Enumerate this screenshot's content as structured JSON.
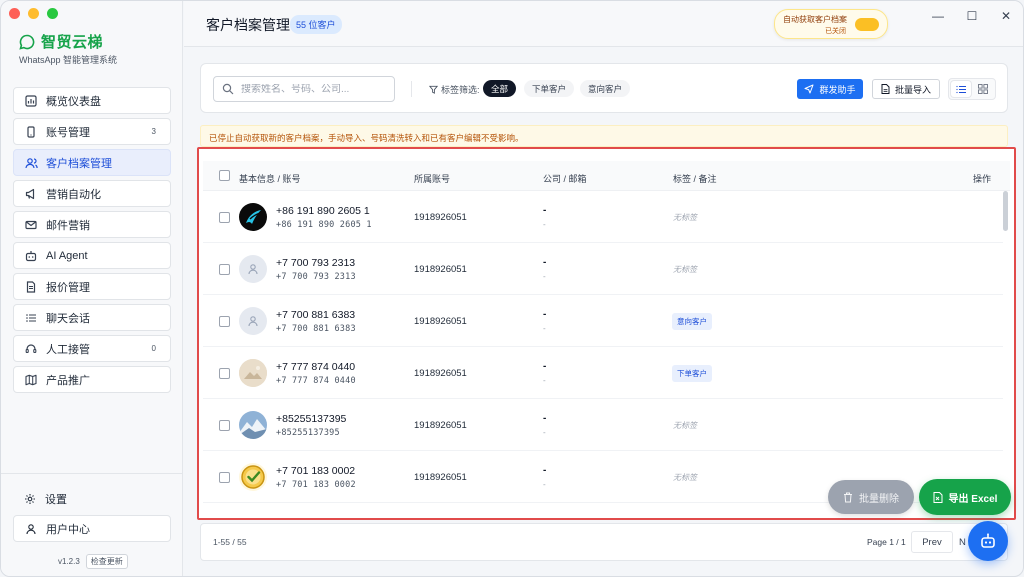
{
  "colors": {
    "brand": "#16a34a",
    "primary": "#1d6ff2",
    "highlight_border": "#e14b4b"
  },
  "sidebar": {
    "brand_name": "智贸云梯",
    "brand_sub": "WhatsApp 智能管理系统",
    "items": [
      {
        "label": "概览仪表盘",
        "icon": "dashboard-icon"
      },
      {
        "label": "账号管理",
        "icon": "phone-icon",
        "badge": "3"
      },
      {
        "label": "客户档案管理",
        "icon": "users-icon",
        "active": true
      },
      {
        "label": "营销自动化",
        "icon": "megaphone-icon"
      },
      {
        "label": "邮件营销",
        "icon": "mail-icon"
      },
      {
        "label": "AI Agent",
        "icon": "robot-icon"
      },
      {
        "label": "报价管理",
        "icon": "document-icon"
      },
      {
        "label": "聊天会话",
        "icon": "list-icon"
      },
      {
        "label": "人工接管",
        "icon": "headset-icon",
        "badge": "0"
      },
      {
        "label": "产品推广",
        "icon": "map-icon"
      }
    ],
    "settings_label": "设置",
    "user_center_label": "用户中心",
    "version": "v1.2.3",
    "check_update_label": "检查更新"
  },
  "header": {
    "title": "客户档案管理",
    "count_badge": "55 位客户",
    "auto_fetch_title": "自动获取客户档案",
    "auto_fetch_status": "已关闭"
  },
  "toolbar": {
    "search_placeholder": "搜索姓名、号码、公司...",
    "filter_label": "标签筛选:",
    "chips": [
      "全部",
      "下单客户",
      "意向客户"
    ],
    "mass_send_label": "群发助手",
    "bulk_import_label": "批量导入"
  },
  "notice": "已停止自动获取新的客户档案，手动导入、号码清洗转入和已有客户编辑不受影响。",
  "table": {
    "columns": [
      "基本信息 / 账号",
      "所属账号",
      "公司 / 邮箱",
      "标签 / 备注",
      "操作"
    ],
    "rows": [
      {
        "phone": "+86 191 890 2605 1",
        "phone_sub": "+86 191 890 2605 1",
        "account": "1918926051",
        "company": "-",
        "email": "-",
        "tag": "无标签",
        "has_tag": false,
        "avatar": "logo-avatar"
      },
      {
        "phone": "+7 700 793 2313",
        "phone_sub": "+7 700 793 2313",
        "account": "1918926051",
        "company": "-",
        "email": "-",
        "tag": "无标签",
        "has_tag": false,
        "avatar": "default-avatar"
      },
      {
        "phone": "+7 700 881 6383",
        "phone_sub": "+7 700 881 6383",
        "account": "1918926051",
        "company": "-",
        "email": "-",
        "tag": "意向客户",
        "has_tag": true,
        "avatar": "default-avatar"
      },
      {
        "phone": "+7 777 874 0440",
        "phone_sub": "+7 777 874 0440",
        "account": "1918926051",
        "company": "-",
        "email": "-",
        "tag": "下单客户",
        "has_tag": true,
        "avatar": "photo-avatar"
      },
      {
        "phone": "+85255137395",
        "phone_sub": "+85255137395",
        "account": "1918926051",
        "company": "-",
        "email": "-",
        "tag": "无标签",
        "has_tag": false,
        "avatar": "mountain-avatar"
      },
      {
        "phone": "+7 701 183 0002",
        "phone_sub": "+7 701 183 0002",
        "account": "1918926051",
        "company": "-",
        "email": "-",
        "tag": "无标签",
        "has_tag": false,
        "avatar": "check-avatar"
      }
    ],
    "bulk_delete_label": "批量删除",
    "export_label": "导出 Excel"
  },
  "pagination": {
    "range": "1-55 / 55",
    "page_info": "Page 1 / 1",
    "prev_label": "Prev",
    "next_label": "N"
  }
}
